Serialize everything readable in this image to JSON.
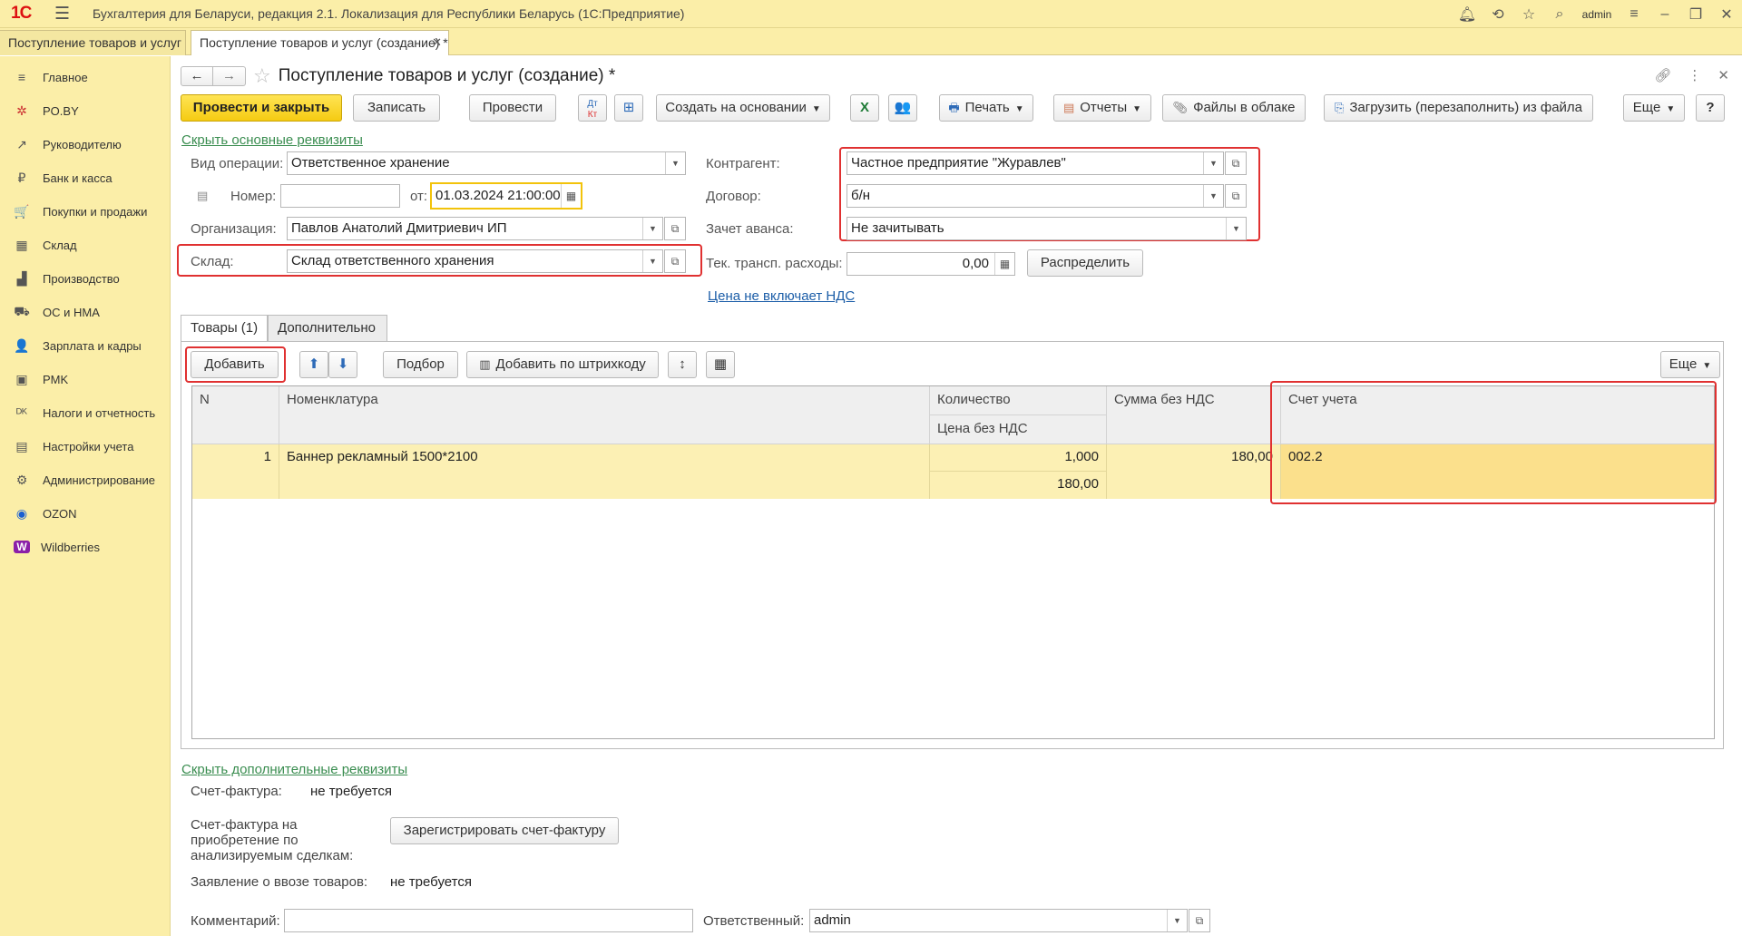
{
  "titlebar": {
    "logo": "1С",
    "title": "Бухгалтерия для Беларуси, редакция 2.1. Локализация для Республики Беларусь   (1С:Предприятие)",
    "user": "admin"
  },
  "tabs": [
    {
      "label": "Поступление товаров и услуг"
    },
    {
      "label": "Поступление товаров и услуг (создание) *"
    }
  ],
  "sidebar": {
    "items": [
      {
        "label": "Главное",
        "icon": "≡"
      },
      {
        "label": "PO.BY",
        "icon": "✲"
      },
      {
        "label": "Руководителю",
        "icon": "↗"
      },
      {
        "label": "Банк и касса",
        "icon": "₽"
      },
      {
        "label": "Покупки и продажи",
        "icon": "🛒"
      },
      {
        "label": "Склад",
        "icon": "▦"
      },
      {
        "label": "Производство",
        "icon": "▟"
      },
      {
        "label": "ОС и НМА",
        "icon": "⛟"
      },
      {
        "label": "Зарплата и кадры",
        "icon": "👤"
      },
      {
        "label": "PMK",
        "icon": "▣"
      },
      {
        "label": "Налоги и отчетность",
        "icon": "ᴰᴷ"
      },
      {
        "label": "Настройки учета",
        "icon": "▤"
      },
      {
        "label": "Администрирование",
        "icon": "⚙"
      },
      {
        "label": "OZON",
        "icon": "◉"
      },
      {
        "label": "Wildberries",
        "icon": "W"
      }
    ]
  },
  "form": {
    "title": "Поступление товаров и услуг (создание) *",
    "toolbar": {
      "post_close": "Провести и закрыть",
      "save": "Записать",
      "post": "Провести",
      "create_based": "Создать на основании",
      "print": "Печать",
      "reports": "Отчеты",
      "cloud_files": "Файлы в облаке",
      "load_file": "Загрузить (перезаполнить) из файла",
      "more": "Еще",
      "help": "?"
    },
    "hide_main_link": "Скрыть основные реквизиты",
    "fields": {
      "operation_label": "Вид операции:",
      "operation_value": "Ответственное хранение",
      "number_label": "Номер:",
      "number_value": "",
      "from_label": "от:",
      "date_value": "01.03.2024 21:00:00",
      "org_label": "Организация:",
      "org_value": "Павлов Анатолий Дмитриевич ИП",
      "warehouse_label": "Склад:",
      "warehouse_value": "Склад ответственного хранения",
      "counterparty_label": "Контрагент:",
      "counterparty_value": "Частное предприятие \"Журавлев\"",
      "contract_label": "Договор:",
      "contract_value": "б/н",
      "advance_label": "Зачет аванса:",
      "advance_value": "Не зачитывать",
      "transport_label": "Тек. трансп. расходы:",
      "transport_value": "0,00",
      "distribute": "Распределить",
      "vat_link": "Цена не включает НДС"
    },
    "tabs": [
      {
        "label": "Товары (1)"
      },
      {
        "label": "Дополнительно"
      }
    ],
    "goods_toolbar": {
      "add": "Добавить",
      "pick": "Подбор",
      "add_barcode": "Добавить по штрихкоду",
      "more": "Еще"
    },
    "grid": {
      "headers": {
        "n": "N",
        "item": "Номенклатура",
        "qty": "Количество",
        "price": "Цена без НДС",
        "sum": "Сумма без НДС",
        "account": "Счет учета"
      },
      "rows": [
        {
          "n": "1",
          "item": "Баннер рекламный 1500*2100",
          "qty": "1,000",
          "price": "180,00",
          "sum": "180,00",
          "account": "002.2"
        }
      ]
    },
    "hide_extra_link": "Скрыть дополнительные реквизиты",
    "extra": {
      "invoice_label": "Счет-фактура:",
      "invoice_value": "не требуется",
      "invoice_purchase_label_1": "Счет-фактура на",
      "invoice_purchase_label_2": "приобретение по",
      "invoice_purchase_label_3": "анализируемым сделкам:",
      "register_invoice": "Зарегистрировать счет-фактуру",
      "import_label": "Заявление о ввозе товаров:",
      "import_value": "не требуется",
      "comment_label": "Комментарий:",
      "comment_value": "",
      "responsible_label": "Ответственный:",
      "responsible_value": "admin"
    }
  },
  "colors": {
    "accent_yellow": "#fbeea8",
    "primary_button": "#f5cb12",
    "highlight_red": "#e03131",
    "link_green": "#3a8d50"
  }
}
